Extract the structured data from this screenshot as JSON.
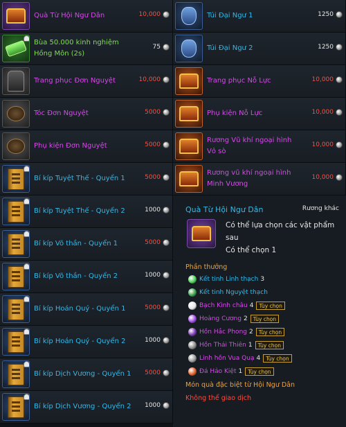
{
  "left_items": [
    {
      "name_l1": "Quà Từ Hội Ngư Dân",
      "name_l2": "",
      "color": "purple",
      "icon": "purple-chest-icon",
      "price": "10,000",
      "price_color": "red",
      "lock": false,
      "thumb": "purple"
    },
    {
      "name_l1": "Bùa 50.000 kinh nghiệm",
      "name_l2": "Hồng Môn (2s)",
      "color": "green",
      "icon": "green-scroll-icon",
      "price": "75",
      "price_color": "white",
      "lock": true,
      "thumb": "green"
    },
    {
      "name_l1": "Trang phục Đơn Nguyệt",
      "name_l2": "",
      "color": "purple",
      "icon": "robe-icon",
      "price": "10,000",
      "price_color": "red",
      "lock": false,
      "thumb": "gray"
    },
    {
      "name_l1": "Tóc Đơn Nguyệt",
      "name_l2": "",
      "color": "purple",
      "icon": "hair-icon",
      "price": "5000",
      "price_color": "red",
      "lock": false,
      "thumb": "gray"
    },
    {
      "name_l1": "Phụ kiện Đơn Nguyệt",
      "name_l2": "",
      "color": "purple",
      "icon": "accessory-icon",
      "price": "5000",
      "price_color": "red",
      "lock": false,
      "thumb": "gray"
    },
    {
      "name_l1": "Bí kíp Tuyệt Thế - Quyển 1",
      "name_l2": "",
      "color": "blue",
      "icon": "book-icon",
      "price": "5000",
      "price_color": "red",
      "lock": true,
      "thumb": "blue"
    },
    {
      "name_l1": "Bí kíp Tuyệt Thế - Quyển 2",
      "name_l2": "",
      "color": "blue",
      "icon": "book-icon",
      "price": "1000",
      "price_color": "white",
      "lock": true,
      "thumb": "blue"
    },
    {
      "name_l1": "Bí kíp Võ thần - Quyển 1",
      "name_l2": "",
      "color": "blue",
      "icon": "book-icon",
      "price": "5000",
      "price_color": "red",
      "lock": true,
      "thumb": "blue"
    },
    {
      "name_l1": "Bí kíp Võ thần - Quyển 2",
      "name_l2": "",
      "color": "blue",
      "icon": "book-icon",
      "price": "1000",
      "price_color": "white",
      "lock": true,
      "thumb": "blue"
    },
    {
      "name_l1": "Bí kíp Hoán Quý - Quyển 1",
      "name_l2": "",
      "color": "blue",
      "icon": "book-icon",
      "price": "5000",
      "price_color": "red",
      "lock": true,
      "thumb": "blue"
    },
    {
      "name_l1": "Bí kíp Hoán Quý - Quyển 2",
      "name_l2": "",
      "color": "blue",
      "icon": "book-icon",
      "price": "1000",
      "price_color": "white",
      "lock": true,
      "thumb": "blue"
    },
    {
      "name_l1": "Bí kíp Dịch Vương - Quyển 1",
      "name_l2": "",
      "color": "blue",
      "icon": "book-icon",
      "price": "5000",
      "price_color": "red",
      "lock": true,
      "thumb": "blue"
    },
    {
      "name_l1": "Bí kíp Dịch Vương - Quyển 2",
      "name_l2": "",
      "color": "blue",
      "icon": "book-icon",
      "price": "1000",
      "price_color": "white",
      "lock": true,
      "thumb": "blue"
    }
  ],
  "right_items": [
    {
      "name_l1": "Túi Đại Ngư 1",
      "name_l2": "",
      "color": "blue",
      "icon": "fish-bag-icon",
      "price": "1250",
      "price_color": "white",
      "lock": false,
      "thumb": "blue"
    },
    {
      "name_l1": "Túi Đại Ngư 2",
      "name_l2": "",
      "color": "blue",
      "icon": "fish-bag-icon",
      "price": "1250",
      "price_color": "white",
      "lock": false,
      "thumb": "blue"
    },
    {
      "name_l1": "Trang phục Nỗ Lực",
      "name_l2": "",
      "color": "purple",
      "icon": "outfit-box-icon",
      "price": "10,000",
      "price_color": "red",
      "lock": false,
      "thumb": "orange"
    },
    {
      "name_l1": "Phụ kiện Nỗ Lực",
      "name_l2": "",
      "color": "purple",
      "icon": "accessory-box-icon",
      "price": "10,000",
      "price_color": "red",
      "lock": false,
      "thumb": "orange"
    },
    {
      "name_l1": "Rương Vũ khí ngoại hình",
      "name_l2": "Vỏ sò",
      "color": "purple",
      "icon": "weapon-chest-icon",
      "price": "10,000",
      "price_color": "red",
      "lock": false,
      "thumb": "orange"
    },
    {
      "name_l1": "Rương vũ khí ngoại hình",
      "name_l2": "Minh Vương",
      "color": "purple",
      "icon": "weapon-chest-icon",
      "price": "10,000",
      "price_color": "red",
      "lock": false,
      "thumb": "orange"
    }
  ],
  "tooltip": {
    "title": "Quà Từ Hội Ngư Dân",
    "type": "Rương khác",
    "desc_l1": "Có thể lựa chọn các vật phẩm sau",
    "desc_l2": "Có thể chọn 1",
    "section_title": "Phần thưởng",
    "rewards": [
      {
        "name": "Kết tinh Linh thạch",
        "count": "3",
        "color": "blue",
        "option": "",
        "icon": "green-crystal-icon",
        "icon_color": "#4ccf5a"
      },
      {
        "name": "Kết tinh Nguyệt thạch",
        "count": "",
        "color": "blue",
        "option": "",
        "icon": "green-crystal-icon",
        "icon_color": "#3aa04a"
      },
      {
        "name": "Bạch Kình châu",
        "count": "4",
        "color": "purple",
        "option": "Tùy chọn",
        "icon": "white-pearl-icon",
        "icon_color": "#e6e6e6"
      },
      {
        "name": "Hoàng Cương",
        "count": "2",
        "color": "purple",
        "option": "Tùy chọn",
        "icon": "purple-gem-icon",
        "icon_color": "#a04ce0"
      },
      {
        "name": "Hồn Hắc Phong",
        "count": "2",
        "color": "purple",
        "option": "Tùy chọn",
        "icon": "purple-gem-icon",
        "icon_color": "#7a3ab0"
      },
      {
        "name": "Hồn Thái Thiên",
        "count": "1",
        "color": "purple",
        "option": "Tùy chọn",
        "icon": "gray-gem-icon",
        "icon_color": "#8a8a8a"
      },
      {
        "name": "Linh hồn Vua Quạ",
        "count": "4",
        "color": "purple",
        "option": "Tùy chọn",
        "icon": "gray-gem-icon",
        "icon_color": "#9a9a9a"
      },
      {
        "name": "Đá Hảo Kiệt",
        "count": "1",
        "color": "purple",
        "option": "Tùy chọn",
        "icon": "orange-stone-icon",
        "icon_color": "#e0602a"
      }
    ],
    "special": "Món quà đặc biệt từ Hội Ngư Dân",
    "notrade": "Không thể giao dịch"
  }
}
